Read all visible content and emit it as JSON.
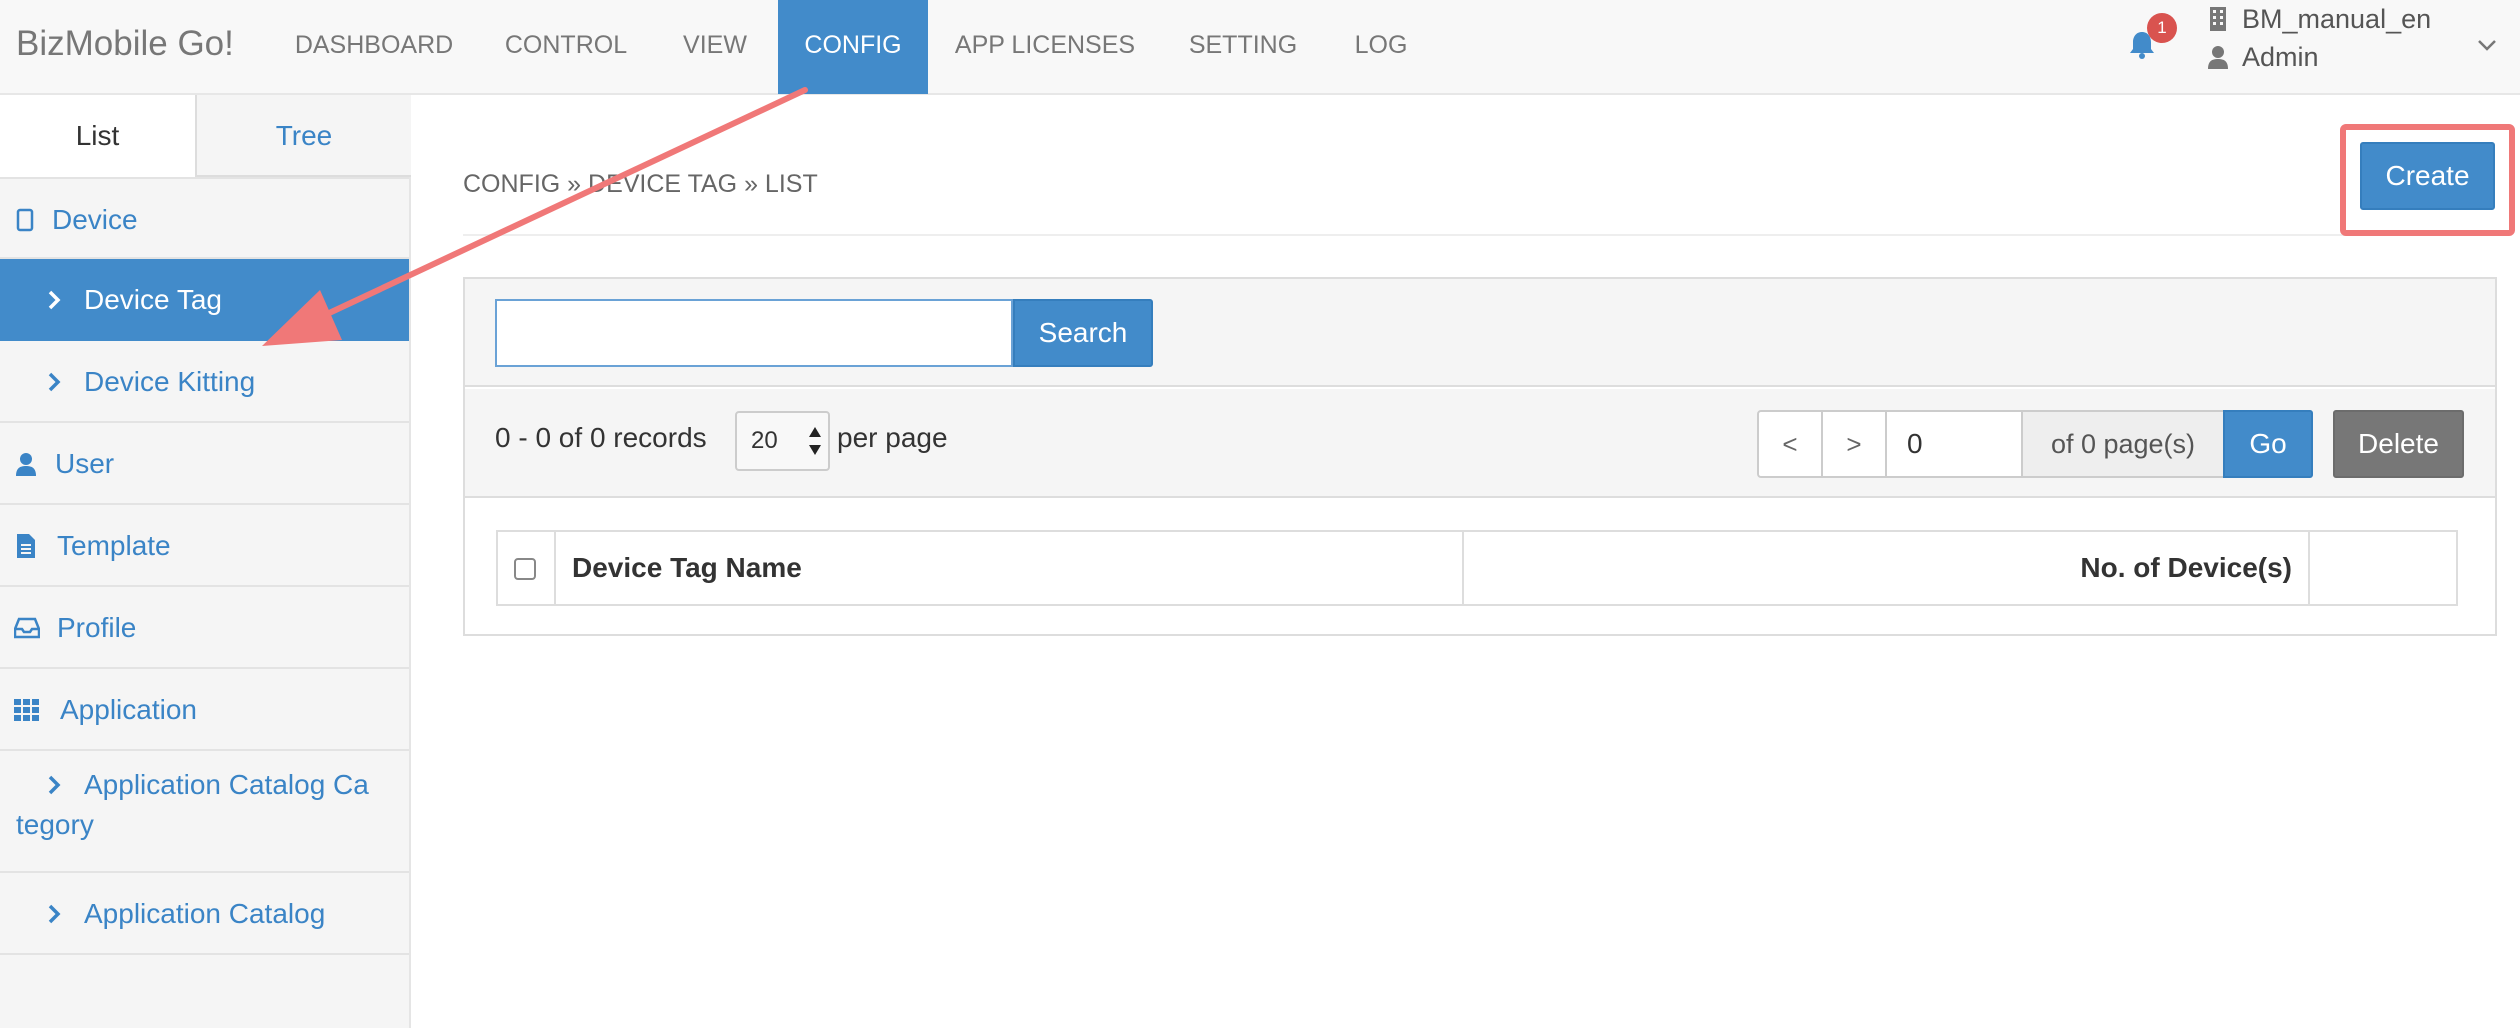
{
  "navbar": {
    "brand": "BizMobile Go!",
    "tabs": [
      {
        "label": "DASHBOARD"
      },
      {
        "label": "CONTROL"
      },
      {
        "label": "VIEW"
      },
      {
        "label": "CONFIG",
        "active": true
      },
      {
        "label": "APP LICENSES"
      },
      {
        "label": "SETTING"
      },
      {
        "label": "LOG"
      }
    ],
    "notification_count": "1",
    "org_name": "BM_manual_en",
    "user_name": "Admin",
    "icons": {
      "bell": "bell-icon",
      "org": "building-icon",
      "user": "user-icon",
      "caret": "chevron-down-icon"
    }
  },
  "sidebar": {
    "tabs": [
      {
        "label": "List",
        "active": true
      },
      {
        "label": "Tree"
      }
    ],
    "items": [
      {
        "label": "Device",
        "icon": "tablet-icon"
      },
      {
        "label": "Device Tag",
        "icon": "chevron-right-icon",
        "active": true
      },
      {
        "label": "Device Kitting",
        "icon": "chevron-right-icon"
      },
      {
        "label": "User",
        "icon": "user-icon"
      },
      {
        "label": "Template",
        "icon": "file-icon"
      },
      {
        "label": "Profile",
        "icon": "inbox-icon"
      },
      {
        "label": "Application",
        "icon": "grid-icon"
      },
      {
        "label_line1": "Application Catalog Ca",
        "label_line2": "tegory",
        "icon": "chevron-right-icon"
      },
      {
        "label": "Application Catalog",
        "icon": "chevron-right-icon"
      }
    ]
  },
  "main": {
    "breadcrumb": "CONFIG » DEVICE TAG » LIST",
    "create_button": "Create",
    "search": {
      "value": "",
      "placeholder": "",
      "button": "Search"
    },
    "records_summary": "0 - 0 of 0 records",
    "per_page": {
      "selected": "20",
      "label": "per page"
    },
    "pagination": {
      "prev": "<",
      "next": ">",
      "page_value": "0",
      "of_pages": "of 0 page(s)",
      "go": "Go"
    },
    "delete_button": "Delete",
    "table": {
      "columns": [
        "Device Tag Name",
        "No. of Device(s)"
      ]
    }
  },
  "colors": {
    "primary": "#428bca",
    "link": "#3a84c6",
    "annotation": "#f07878",
    "badge": "#d9534f",
    "delete": "#777777"
  }
}
